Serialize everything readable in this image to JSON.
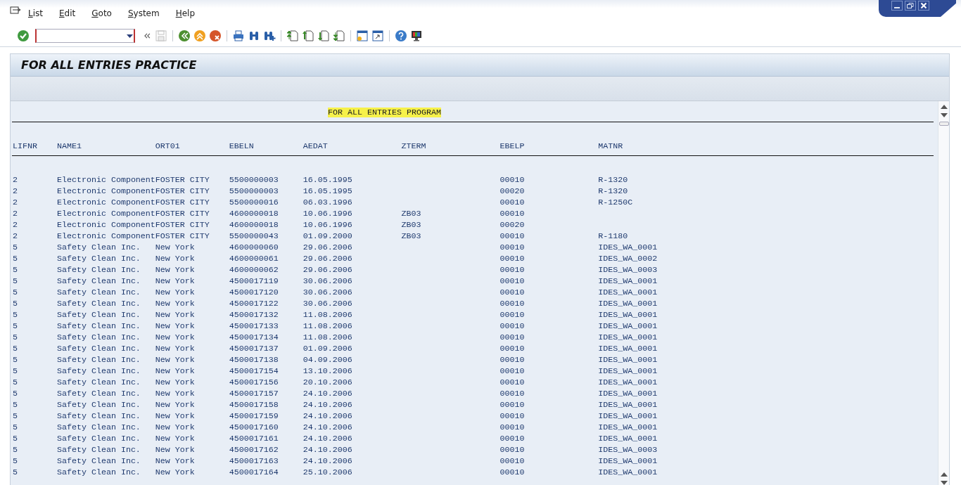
{
  "menu": [
    {
      "label": "List"
    },
    {
      "label": "Edit"
    },
    {
      "label": "Goto"
    },
    {
      "label": "System"
    },
    {
      "label": "Help"
    }
  ],
  "toolbar": {
    "save_disabled": true
  },
  "screen_title": "FOR ALL ENTRIES PRACTICE",
  "list": {
    "heading": "FOR ALL ENTRIES PROGRAM",
    "columns": [
      "LIFNR",
      "NAME1",
      "ORT01",
      "EBELN",
      "AEDAT",
      "ZTERM",
      "EBELP",
      "MATNR"
    ],
    "rows": [
      [
        "2",
        "Electronic Component",
        "FOSTER CITY",
        "5500000003",
        "16.05.1995",
        null,
        "00010",
        "R-1320"
      ],
      [
        "2",
        "Electronic Component",
        "FOSTER CITY",
        "5500000003",
        "16.05.1995",
        null,
        "00020",
        "R-1320"
      ],
      [
        "2",
        "Electronic Component",
        "FOSTER CITY",
        "5500000016",
        "06.03.1996",
        null,
        "00010",
        "R-1250C"
      ],
      [
        "2",
        "Electronic Component",
        "FOSTER CITY",
        "4600000018",
        "10.06.1996",
        "ZB03",
        "00010",
        null
      ],
      [
        "2",
        "Electronic Component",
        "FOSTER CITY",
        "4600000018",
        "10.06.1996",
        "ZB03",
        "00020",
        null
      ],
      [
        "2",
        "Electronic Component",
        "FOSTER CITY",
        "5500000043",
        "01.09.2000",
        "ZB03",
        "00010",
        "R-1180"
      ],
      [
        "5",
        "Safety Clean Inc.",
        "New York",
        "4600000060",
        "29.06.2006",
        null,
        "00010",
        "IDES_WA_0001"
      ],
      [
        "5",
        "Safety Clean Inc.",
        "New York",
        "4600000061",
        "29.06.2006",
        null,
        "00010",
        "IDES_WA_0002"
      ],
      [
        "5",
        "Safety Clean Inc.",
        "New York",
        "4600000062",
        "29.06.2006",
        null,
        "00010",
        "IDES_WA_0003"
      ],
      [
        "5",
        "Safety Clean Inc.",
        "New York",
        "4500017119",
        "30.06.2006",
        null,
        "00010",
        "IDES_WA_0001"
      ],
      [
        "5",
        "Safety Clean Inc.",
        "New York",
        "4500017120",
        "30.06.2006",
        null,
        "00010",
        "IDES_WA_0001"
      ],
      [
        "5",
        "Safety Clean Inc.",
        "New York",
        "4500017122",
        "30.06.2006",
        null,
        "00010",
        "IDES_WA_0001"
      ],
      [
        "5",
        "Safety Clean Inc.",
        "New York",
        "4500017132",
        "11.08.2006",
        null,
        "00010",
        "IDES_WA_0001"
      ],
      [
        "5",
        "Safety Clean Inc.",
        "New York",
        "4500017133",
        "11.08.2006",
        null,
        "00010",
        "IDES_WA_0001"
      ],
      [
        "5",
        "Safety Clean Inc.",
        "New York",
        "4500017134",
        "11.08.2006",
        null,
        "00010",
        "IDES_WA_0001"
      ],
      [
        "5",
        "Safety Clean Inc.",
        "New York",
        "4500017137",
        "01.09.2006",
        null,
        "00010",
        "IDES_WA_0001"
      ],
      [
        "5",
        "Safety Clean Inc.",
        "New York",
        "4500017138",
        "04.09.2006",
        null,
        "00010",
        "IDES_WA_0001"
      ],
      [
        "5",
        "Safety Clean Inc.",
        "New York",
        "4500017154",
        "13.10.2006",
        null,
        "00010",
        "IDES_WA_0001"
      ],
      [
        "5",
        "Safety Clean Inc.",
        "New York",
        "4500017156",
        "20.10.2006",
        null,
        "00010",
        "IDES_WA_0001"
      ],
      [
        "5",
        "Safety Clean Inc.",
        "New York",
        "4500017157",
        "24.10.2006",
        null,
        "00010",
        "IDES_WA_0001"
      ],
      [
        "5",
        "Safety Clean Inc.",
        "New York",
        "4500017158",
        "24.10.2006",
        null,
        "00010",
        "IDES_WA_0001"
      ],
      [
        "5",
        "Safety Clean Inc.",
        "New York",
        "4500017159",
        "24.10.2006",
        null,
        "00010",
        "IDES_WA_0001"
      ],
      [
        "5",
        "Safety Clean Inc.",
        "New York",
        "4500017160",
        "24.10.2006",
        null,
        "00010",
        "IDES_WA_0001"
      ],
      [
        "5",
        "Safety Clean Inc.",
        "New York",
        "4500017161",
        "24.10.2006",
        null,
        "00010",
        "IDES_WA_0001"
      ],
      [
        "5",
        "Safety Clean Inc.",
        "New York",
        "4500017162",
        "24.10.2006",
        null,
        "00010",
        "IDES_WA_0003"
      ],
      [
        "5",
        "Safety Clean Inc.",
        "New York",
        "4500017163",
        "24.10.2006",
        null,
        "00010",
        "IDES_WA_0001"
      ],
      [
        "5",
        "Safety Clean Inc.",
        "New York",
        "4500017164",
        "25.10.2006",
        null,
        "00010",
        "IDES_WA_0001"
      ]
    ]
  }
}
